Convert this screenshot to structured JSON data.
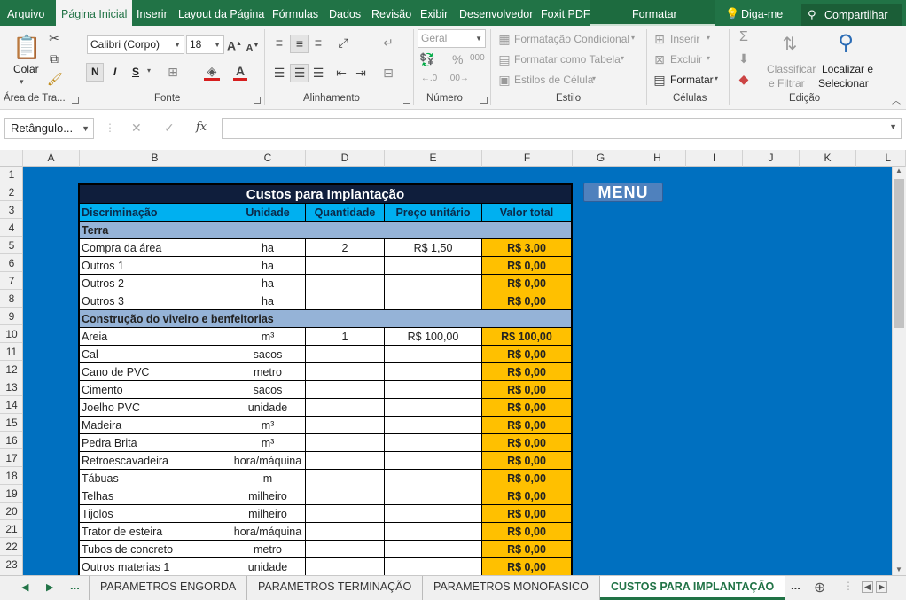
{
  "menu_tabs": [
    "Arquivo",
    "Página Inicial",
    "Inserir",
    "Layout da Página",
    "Fórmulas",
    "Dados",
    "Revisão",
    "Exibir",
    "Desenvolvedor",
    "Foxit PDF"
  ],
  "context_tab": "Formatar",
  "tell_me": "Diga-me",
  "share": "Compartilhar",
  "ribbon": {
    "clipboard": {
      "paste": "Colar",
      "label": "Área de Tra..."
    },
    "font": {
      "name": "Calibri (Corpo)",
      "size": "18",
      "bold": "N",
      "italic": "I",
      "underline": "S",
      "label": "Fonte"
    },
    "alignment": {
      "label": "Alinhamento"
    },
    "number": {
      "format": "Geral",
      "percent": "%",
      "thousands": "000",
      "label": "Número"
    },
    "styles": {
      "conditional": "Formatação Condicional",
      "as_table": "Formatar como Tabela",
      "cell_styles": "Estilos de Célula",
      "label": "Estilo"
    },
    "cells": {
      "insert": "Inserir",
      "delete": "Excluir",
      "format": "Formatar",
      "label": "Células"
    },
    "editing": {
      "sort_1": "Classificar",
      "sort_2": "e Filtrar",
      "find_1": "Localizar e",
      "find_2": "Selecionar",
      "label": "Edição"
    }
  },
  "formula_bar": {
    "name_box": "Retângulo...",
    "fx": "fx",
    "cancel": "✕",
    "confirm": "✓"
  },
  "columns": [
    "A",
    "B",
    "C",
    "D",
    "E",
    "F",
    "G",
    "H",
    "I",
    "J",
    "K",
    "L"
  ],
  "rows": [
    "1",
    "2",
    "3",
    "4",
    "5",
    "6",
    "7",
    "8",
    "9",
    "10",
    "11",
    "12",
    "13",
    "14",
    "15",
    "16",
    "17",
    "18",
    "19",
    "20",
    "21",
    "22",
    "23"
  ],
  "table": {
    "title": "Custos para Implantação",
    "headers": [
      "Discriminação",
      "Unidade",
      "Quantidade",
      "Preço unitário",
      "Valor total"
    ],
    "section_terra": "Terra",
    "terra_rows": [
      {
        "item": "Compra da área",
        "unit": "ha",
        "qty": "2",
        "price": "R$ 1,50",
        "total": "R$ 3,00"
      },
      {
        "item": "Outros 1",
        "unit": "ha",
        "qty": "",
        "price": "",
        "total": "R$ 0,00"
      },
      {
        "item": "Outros 2",
        "unit": "ha",
        "qty": "",
        "price": "",
        "total": "R$ 0,00"
      },
      {
        "item": "Outros 3",
        "unit": "ha",
        "qty": "",
        "price": "",
        "total": "R$ 0,00"
      }
    ],
    "section_construcao": "Construção do viveiro e benfeitorias",
    "construcao_rows": [
      {
        "item": "Areia",
        "unit": "m³",
        "qty": "1",
        "price": "R$ 100,00",
        "total": "R$ 100,00"
      },
      {
        "item": "Cal",
        "unit": "sacos",
        "qty": "",
        "price": "",
        "total": "R$ 0,00"
      },
      {
        "item": "Cano de PVC",
        "unit": "metro",
        "qty": "",
        "price": "",
        "total": "R$ 0,00"
      },
      {
        "item": "Cimento",
        "unit": "sacos",
        "qty": "",
        "price": "",
        "total": "R$ 0,00"
      },
      {
        "item": "Joelho PVC",
        "unit": "unidade",
        "qty": "",
        "price": "",
        "total": "R$ 0,00"
      },
      {
        "item": "Madeira",
        "unit": "m³",
        "qty": "",
        "price": "",
        "total": "R$ 0,00"
      },
      {
        "item": "Pedra Brita",
        "unit": "m³",
        "qty": "",
        "price": "",
        "total": "R$ 0,00"
      },
      {
        "item": "Retroescavadeira",
        "unit": "hora/máquina",
        "qty": "",
        "price": "",
        "total": "R$ 0,00"
      },
      {
        "item": "Tábuas",
        "unit": "m",
        "qty": "",
        "price": "",
        "total": "R$ 0,00"
      },
      {
        "item": "Telhas",
        "unit": "milheiro",
        "qty": "",
        "price": "",
        "total": "R$ 0,00"
      },
      {
        "item": "Tijolos",
        "unit": "milheiro",
        "qty": "",
        "price": "",
        "total": "R$ 0,00"
      },
      {
        "item": "Trator de esteira",
        "unit": "hora/máquina",
        "qty": "",
        "price": "",
        "total": "R$ 0,00"
      },
      {
        "item": "Tubos de concreto",
        "unit": "metro",
        "qty": "",
        "price": "",
        "total": "R$ 0,00"
      },
      {
        "item": "Outros materias 1",
        "unit": "unidade",
        "qty": "",
        "price": "",
        "total": "R$ 0,00"
      }
    ]
  },
  "menu_button": "MENU",
  "sheet_tabs": [
    "PARAMETROS ENGORDA",
    "PARAMETROS TERMINAÇÃO",
    "PARAMETROS MONOFASICO",
    "CUSTOS PARA IMPLANTAÇÃO"
  ],
  "active_sheet": "CUSTOS PARA IMPLANTAÇÃO",
  "colors": {
    "excel_green": "#217346",
    "sheet_bg": "#0070c0",
    "title_bg": "#0f1e3c",
    "header_bg": "#00b0f0",
    "section_bg": "#95b3d7",
    "total_bg": "#ffc000",
    "menu_btn": "#4f81bd"
  }
}
